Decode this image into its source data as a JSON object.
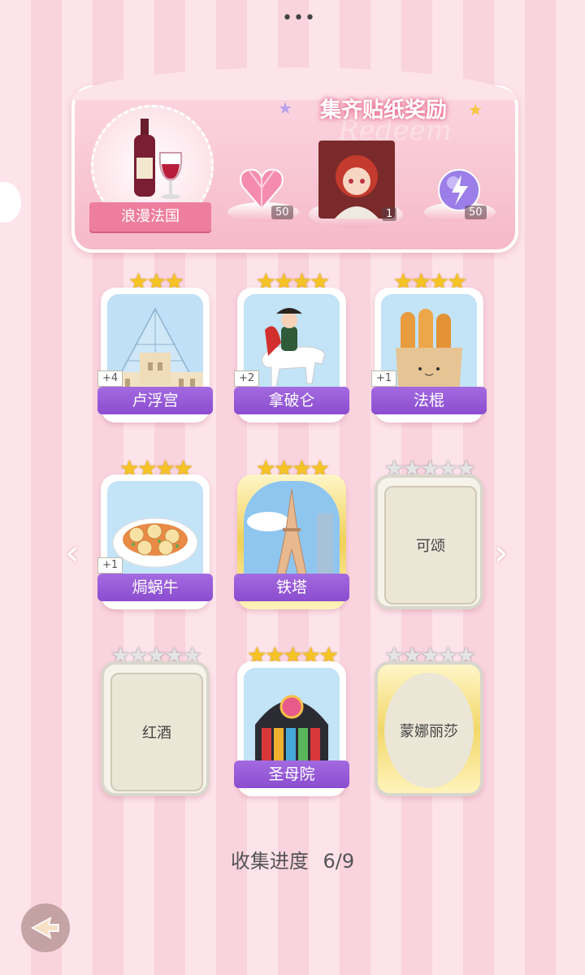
{
  "banner": {
    "title": "集齐贴纸奖励",
    "deco_text": "Redeem",
    "theme_name": "浪漫法国",
    "rewards": [
      {
        "icon": "pink-heart-gem-icon",
        "count": "50"
      },
      {
        "icon": "character-portrait",
        "count": "1"
      },
      {
        "icon": "purple-lightning-orb-icon",
        "count": "50"
      }
    ]
  },
  "cards": [
    {
      "name": "卢浮宫",
      "stars": 3,
      "star_type": "gold",
      "collected": true,
      "plus": "+4",
      "art": "louvre-art"
    },
    {
      "name": "拿破仑",
      "stars": 4,
      "star_type": "gold",
      "collected": true,
      "plus": "+2",
      "art": "napoleon-art"
    },
    {
      "name": "法棍",
      "stars": 4,
      "star_type": "gold",
      "collected": true,
      "plus": "+1",
      "art": "baguette-art"
    },
    {
      "name": "焗蜗牛",
      "stars": 4,
      "star_type": "gold",
      "collected": true,
      "plus": "+1",
      "art": "escargot-art"
    },
    {
      "name": "铁塔",
      "stars": 4,
      "star_type": "gold",
      "collected": true,
      "plus": "",
      "art": "eiffel-tower-art"
    },
    {
      "name": "可颂",
      "stars": 5,
      "star_type": "silver",
      "collected": false,
      "plus": "",
      "art": "locked"
    },
    {
      "name": "红酒",
      "stars": 5,
      "star_type": "silver",
      "collected": false,
      "plus": "",
      "art": "locked"
    },
    {
      "name": "圣母院",
      "stars": 5,
      "star_type": "gold",
      "collected": true,
      "plus": "",
      "art": "notre-dame-art"
    },
    {
      "name": "蒙娜丽莎",
      "stars": 5,
      "star_type": "silver",
      "collected": false,
      "plus": "",
      "art": "locked-oval"
    }
  ],
  "progress": {
    "label": "收集进度",
    "value": "6/9",
    "collected": 6,
    "total": 9
  },
  "nav": {
    "prev_icon": "chevron-left-icon",
    "next_icon": "chevron-right-icon",
    "back_icon": "back-arrow-icon"
  },
  "menu_icon": "more-dots-icon"
}
